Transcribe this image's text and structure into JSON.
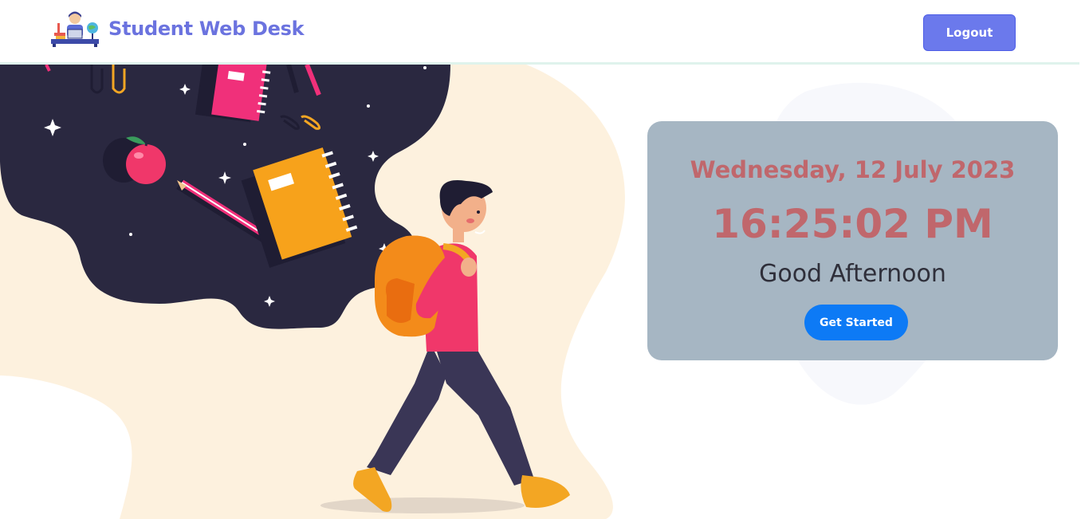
{
  "header": {
    "brand_title": "Student Web Desk",
    "logout_label": "Logout"
  },
  "clock": {
    "date": "Wednesday, 12 July 2023",
    "time": "16:25:02 PM",
    "greeting": "Good Afternoon",
    "cta_label": "Get Started"
  },
  "colors": {
    "brand": "#6b73df",
    "logout_button": "#6b79ec",
    "card_background": "#a6b6c3",
    "clock_text": "#c0676c",
    "cta_button": "#0d7af5"
  },
  "icons": {
    "logo": "student-desk-logo-icon",
    "illustration": "student-walking-illustration"
  }
}
